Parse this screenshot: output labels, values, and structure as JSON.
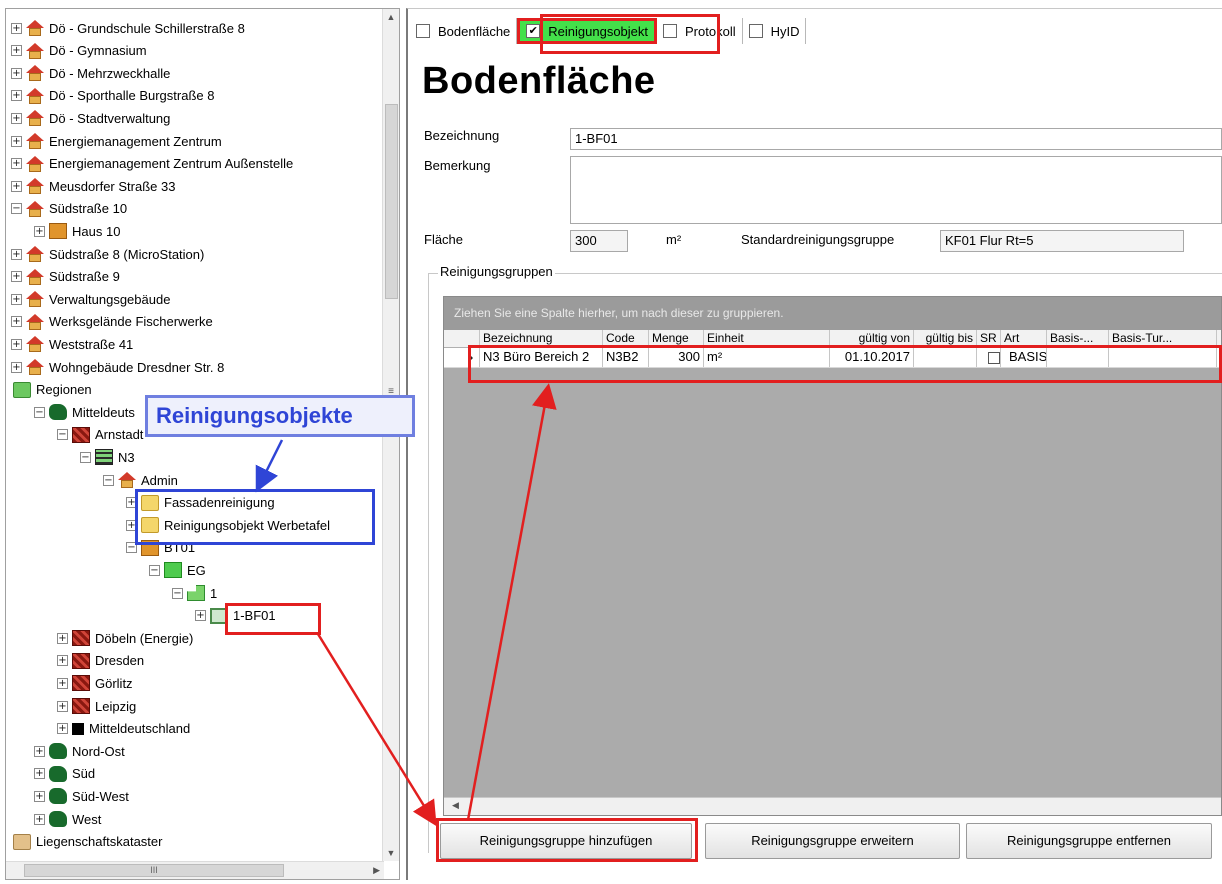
{
  "tree": {
    "nodes": [
      {
        "label": "Dö - Grundschule Schillerstraße 8",
        "icon": "house-icon",
        "expand": "+"
      },
      {
        "label": "Dö - Gymnasium",
        "icon": "house-icon",
        "expand": "+"
      },
      {
        "label": "Dö - Mehrzweckhalle",
        "icon": "house-icon",
        "expand": "+"
      },
      {
        "label": "Dö - Sporthalle Burgstraße 8",
        "icon": "house-icon",
        "expand": "+"
      },
      {
        "label": "Dö - Stadtverwaltung",
        "icon": "house-icon",
        "expand": "+"
      },
      {
        "label": "Energiemanagement Zentrum",
        "icon": "house-icon",
        "expand": "+"
      },
      {
        "label": "Energiemanagement Zentrum Außenstelle",
        "icon": "house-icon",
        "expand": "+"
      },
      {
        "label": "Meusdorfer Straße 33",
        "icon": "house-icon",
        "expand": "+"
      },
      {
        "label": "Südstraße 10",
        "icon": "house-icon",
        "expand": "−"
      },
      {
        "label": "Haus 10",
        "icon": "building-icon",
        "expand": "+"
      },
      {
        "label": "Südstraße 8 (MicroStation)",
        "icon": "house-icon",
        "expand": "+"
      },
      {
        "label": "Südstraße 9",
        "icon": "house-icon",
        "expand": "+"
      },
      {
        "label": "Verwaltungsgebäude",
        "icon": "house-icon",
        "expand": "+"
      },
      {
        "label": "Werksgelände Fischerwerke",
        "icon": "house-icon",
        "expand": "+"
      },
      {
        "label": "Weststraße 41",
        "icon": "house-icon",
        "expand": "+"
      },
      {
        "label": "Wohngebäude Dresdner Str. 8",
        "icon": "house-icon",
        "expand": "+"
      },
      {
        "label": "Regionen",
        "icon": "folder-green-icon",
        "expand": ""
      },
      {
        "label": "Mitteldeuts",
        "icon": "region-icon",
        "expand": "−"
      },
      {
        "label": "Arnstadt",
        "icon": "map-icon",
        "expand": "−"
      },
      {
        "label": "N3",
        "icon": "grid-icon",
        "expand": "−"
      },
      {
        "label": "Admin",
        "icon": "house-icon",
        "expand": "−"
      },
      {
        "label": "Fassadenreinigung",
        "icon": "folder-yellow-icon",
        "expand": "+"
      },
      {
        "label": "Reinigungsobjekt Werbetafel",
        "icon": "folder-yellow-icon",
        "expand": "+"
      },
      {
        "label": "BT01",
        "icon": "building-icon",
        "expand": "−"
      },
      {
        "label": "EG",
        "icon": "floor-icon",
        "expand": "−"
      },
      {
        "label": "1",
        "icon": "room-icon",
        "expand": "−"
      },
      {
        "label": "1-BF01",
        "icon": "floor-area-icon",
        "expand": "+"
      },
      {
        "label": "Döbeln (Energie)",
        "icon": "map-icon",
        "expand": "+"
      },
      {
        "label": "Dresden",
        "icon": "map-icon",
        "expand": "+"
      },
      {
        "label": "Görlitz",
        "icon": "map-icon",
        "expand": "+"
      },
      {
        "label": "Leipzig",
        "icon": "map-icon",
        "expand": "+"
      },
      {
        "label": "Mitteldeutschland",
        "icon": "square-icon",
        "expand": "+"
      },
      {
        "label": "Nord-Ost",
        "icon": "region-icon",
        "expand": "+"
      },
      {
        "label": "Süd",
        "icon": "region-icon",
        "expand": "+"
      },
      {
        "label": "Süd-West",
        "icon": "region-icon",
        "expand": "+"
      },
      {
        "label": "West",
        "icon": "region-icon",
        "expand": "+"
      },
      {
        "label": "Liegenschaftskataster",
        "icon": "folder-tan-icon",
        "expand": ""
      }
    ],
    "hscroll_grip": "III"
  },
  "tabs": [
    {
      "label": "Bodenfläche",
      "checked": false
    },
    {
      "label": "Reinigungsobjekt",
      "checked": true
    },
    {
      "label": "Protokoll",
      "checked": false
    },
    {
      "label": "HyID",
      "checked": false
    }
  ],
  "form": {
    "title": "Bodenfläche",
    "bezeichnung_label": "Bezeichnung",
    "bezeichnung_value": "1-BF01",
    "bemerkung_label": "Bemerkung",
    "bemerkung_value": "",
    "flaeche_label": "Fläche",
    "flaeche_value": "300",
    "flaeche_unit": "m²",
    "std_group_label": "Standardreinigungsgruppe",
    "std_group_value": "KF01 Flur Rt=5"
  },
  "groups": {
    "legend": "Reinigungsgruppen",
    "hint": "Ziehen Sie eine Spalte hierher, um nach dieser zu gruppieren.",
    "columns": [
      "Bezeichnung",
      "Code",
      "Menge",
      "Einheit",
      "gültig von",
      "gültig bis",
      "SR",
      "Art",
      "Basis-...",
      "Basis-Tur..."
    ],
    "rows": [
      {
        "bezeichnung": "N3 Büro Bereich 2",
        "code": "N3B2",
        "menge": "300",
        "einheit": "m²",
        "gueltig_von": "01.10.2017",
        "gueltig_bis": "",
        "sr": false,
        "art": "BASIS",
        "basis": "",
        "basis_tur": ""
      }
    ]
  },
  "buttons": {
    "add": "Reinigungsgruppe hinzufügen",
    "extend": "Reinigungsgruppe erweitern",
    "remove": "Reinigungsgruppe entfernen"
  },
  "annotation": {
    "callout": "Reinigungsobjekte",
    "red": "#e21f1f",
    "blue": "#2f45d6"
  }
}
